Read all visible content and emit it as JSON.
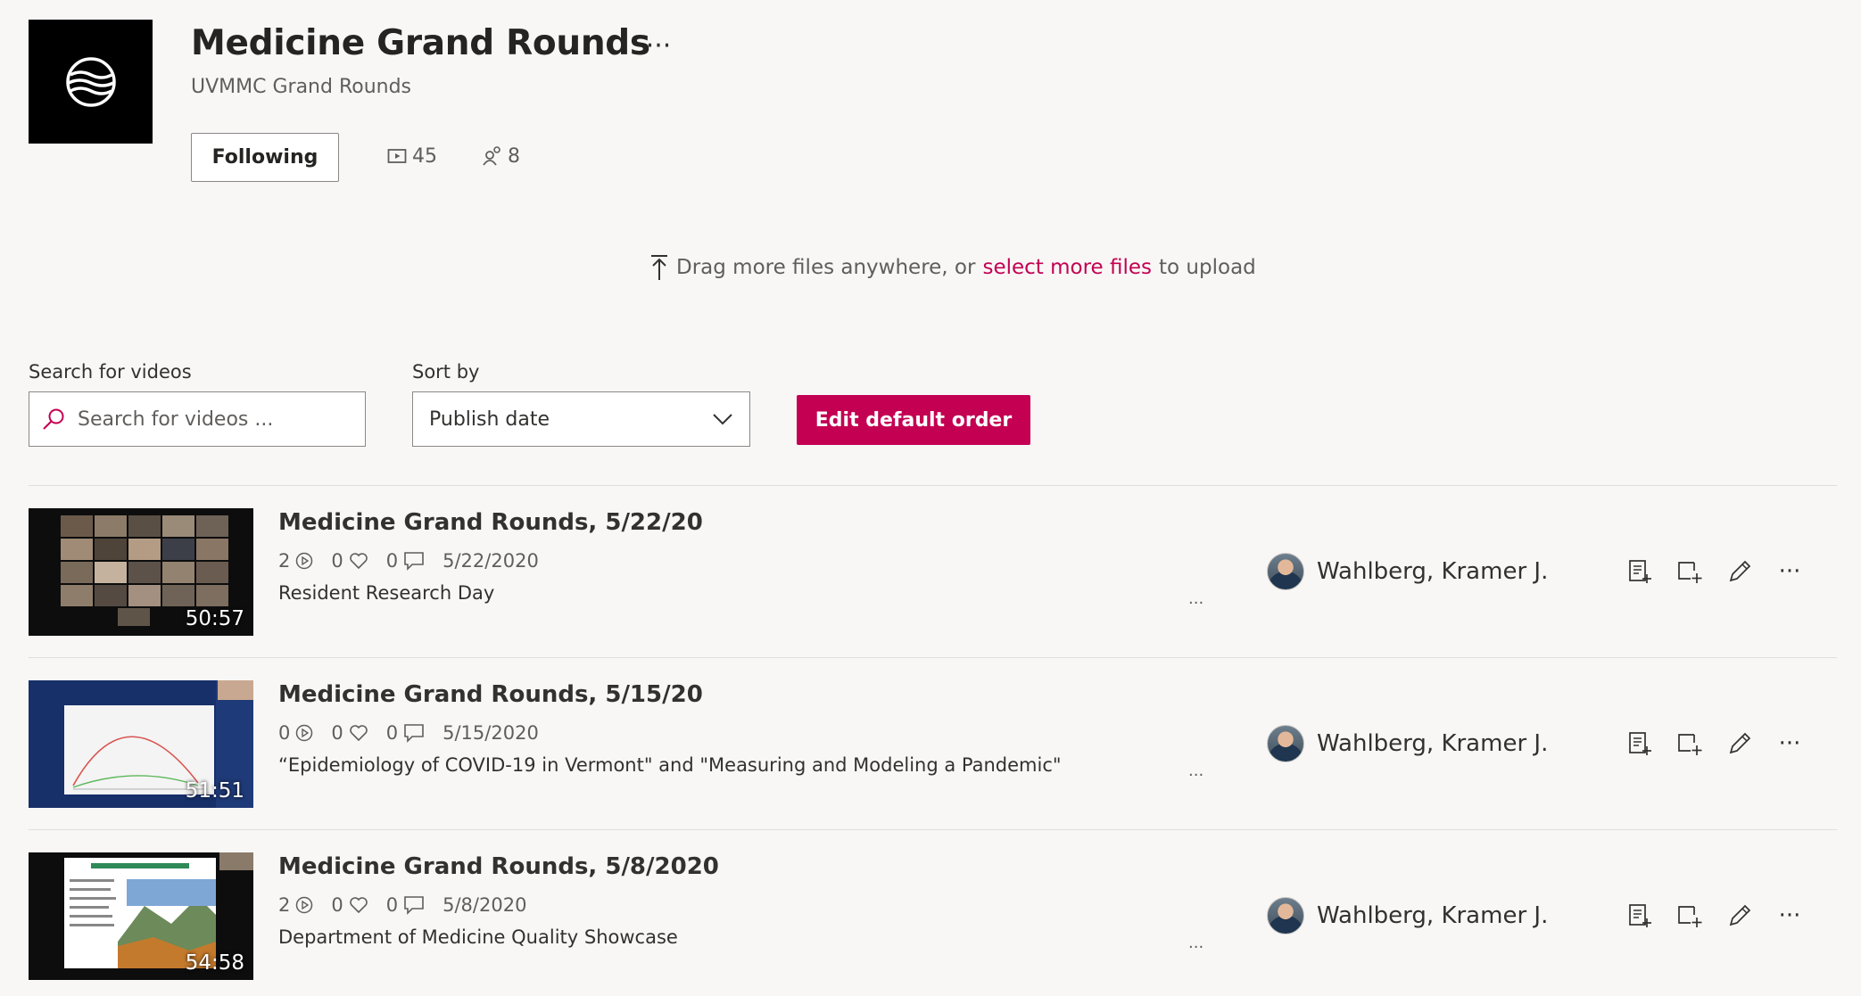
{
  "channel": {
    "title": "Medicine Grand Rounds",
    "subtitle": "UVMMC Grand Rounds",
    "more_label": "···",
    "follow_label": "Following",
    "video_count": "45",
    "follower_count": "8"
  },
  "upload": {
    "prefix": "Drag more files anywhere, or",
    "link": "select more files",
    "suffix": "to upload"
  },
  "search": {
    "label": "Search for videos",
    "placeholder": "Search for videos ..."
  },
  "sort": {
    "label": "Sort by",
    "selected": "Publish date"
  },
  "edit_order_label": "Edit default order",
  "accent_color": "#c30052",
  "videos": [
    {
      "title": "Medicine Grand Rounds, 5/22/20",
      "views": "2",
      "likes": "0",
      "comments": "0",
      "date": "5/22/2020",
      "description": "Resident Research Day",
      "duration": "50:57",
      "owner": "Wahlberg, Kramer J.",
      "desc_more": "..."
    },
    {
      "title": "Medicine Grand Rounds, 5/15/20",
      "views": "0",
      "likes": "0",
      "comments": "0",
      "date": "5/15/2020",
      "description": "“Epidemiology of COVID-19 in Vermont\" and \"Measuring and Modeling a Pandemic\"",
      "duration": "51:51",
      "owner": "Wahlberg, Kramer J.",
      "desc_more": "..."
    },
    {
      "title": "Medicine Grand Rounds, 5/8/2020",
      "views": "2",
      "likes": "0",
      "comments": "0",
      "date": "5/8/2020",
      "description": "Department of Medicine Quality Showcase",
      "duration": "54:58",
      "owner": "Wahlberg, Kramer J.",
      "desc_more": "..."
    }
  ],
  "row_more_label": "···"
}
